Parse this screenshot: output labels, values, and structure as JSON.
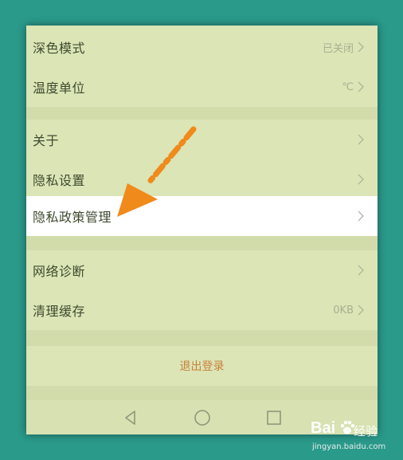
{
  "settings": {
    "group1": [
      {
        "label": "深色模式",
        "value": "已关闭"
      },
      {
        "label": "温度单位",
        "value": "℃"
      }
    ],
    "group2": [
      {
        "label": "关于",
        "value": ""
      },
      {
        "label": "隐私设置",
        "value": ""
      },
      {
        "label": "隐私政策管理",
        "value": ""
      }
    ],
    "group3": [
      {
        "label": "网络诊断",
        "value": ""
      },
      {
        "label": "清理缓存",
        "value": "0KB"
      }
    ],
    "logout_label": "退出登录"
  },
  "navbar": {
    "buttons": [
      "back-icon",
      "home-icon",
      "recents-icon"
    ]
  },
  "watermark": {
    "brand": "Bai",
    "suffix": "经验",
    "url": "jingyan.baidu.com"
  },
  "colors": {
    "arrow": "#f08a1a",
    "highlight_row": "#ffffff",
    "logout_text": "#c9813a"
  }
}
